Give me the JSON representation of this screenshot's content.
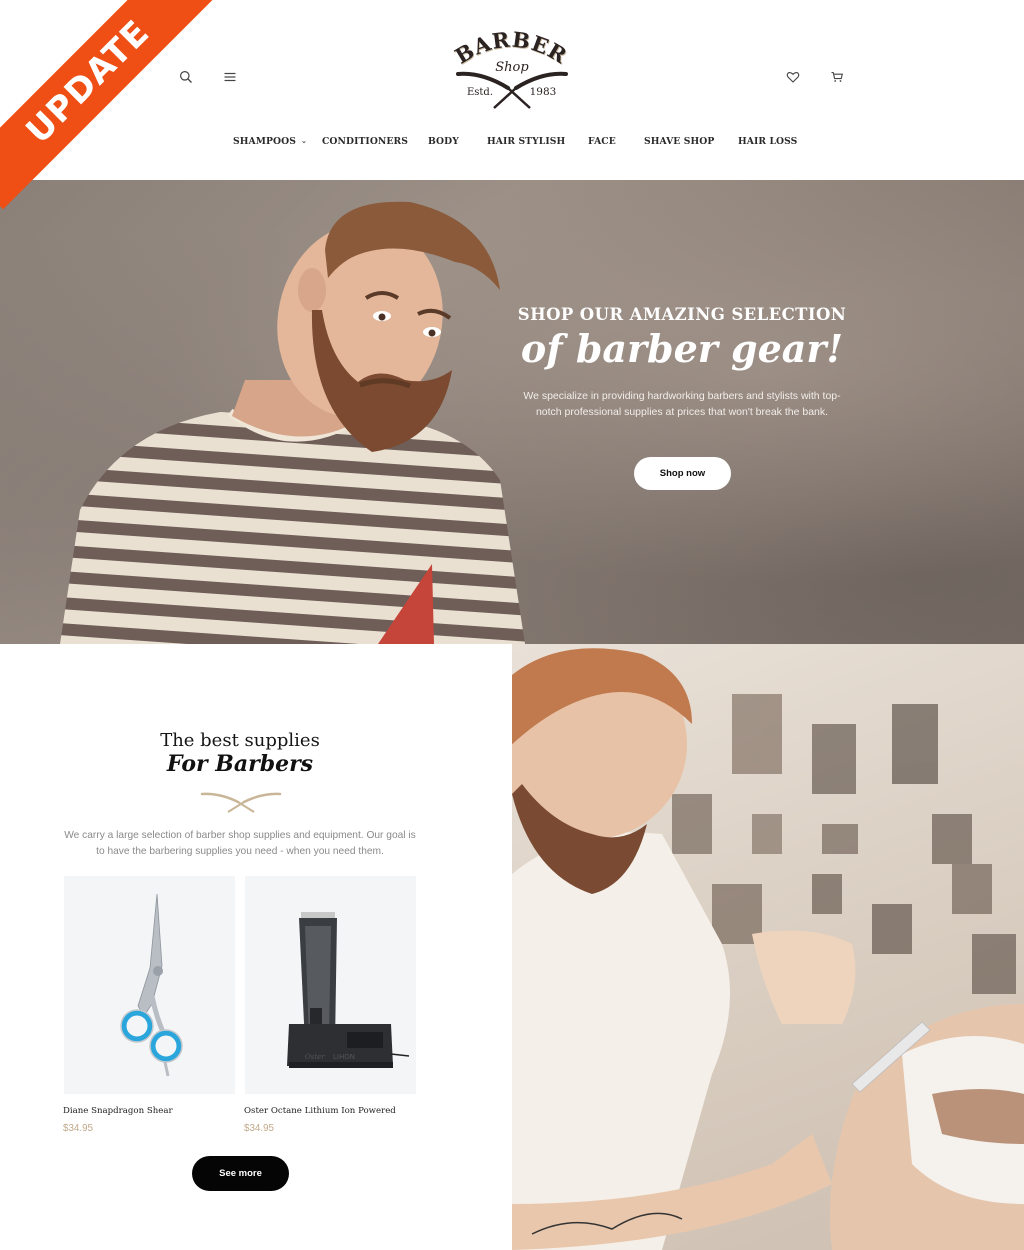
{
  "ribbon": {
    "label": "UPDATE",
    "color": "#ef4e14"
  },
  "header": {
    "logo": {
      "line1": "BARBER",
      "line2": "Shop",
      "estd": "Estd.",
      "year": "1983"
    },
    "icons": {
      "search": "search-icon",
      "menu": "hamburger-menu-icon",
      "wishlist": "heart-icon",
      "cart": "cart-icon"
    }
  },
  "nav": {
    "items": [
      {
        "label": "SHAMPOOS",
        "has_dropdown": true
      },
      {
        "label": "CONDITIONERS"
      },
      {
        "label": "BODY"
      },
      {
        "label": "HAIR STYLISH"
      },
      {
        "label": "FACE"
      },
      {
        "label": "SHAVE SHOP"
      },
      {
        "label": "HAIR LOSS"
      }
    ],
    "caret": "⌄"
  },
  "hero": {
    "kicker": "SHOP OUR AMAZING SELECTION",
    "title": "of barber gear!",
    "description": "We specialize in providing hardworking barbers and stylists with top-notch professional supplies at prices that won't break the bank.",
    "button": "Shop now"
  },
  "supplies": {
    "title": "The best supplies",
    "subtitle": "For Barbers",
    "description": "We carry a large selection of barber shop supplies and equipment. Our goal is to have the barbering supplies you need - when you need them.",
    "products": [
      {
        "name": "Diane Snapdragon Shear",
        "price": "$34.95",
        "image": "scissors"
      },
      {
        "name": "Oster Octane Lithium Ion Powered",
        "price": "$34.95",
        "image": "hair-clipper"
      }
    ],
    "see_more": "See more",
    "accent_color": "#c2a98a"
  }
}
